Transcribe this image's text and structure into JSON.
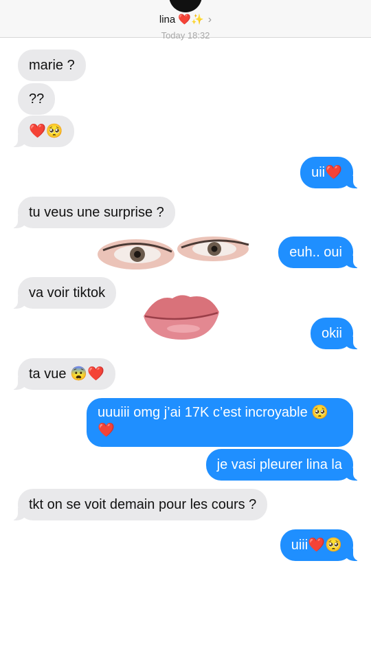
{
  "header": {
    "contact_name": "lina ❤️✨",
    "chevron": "›",
    "timestamp": "Today 18:32"
  },
  "messages": [
    {
      "side": "in",
      "text": "marie ?"
    },
    {
      "side": "in",
      "text": "??"
    },
    {
      "side": "in",
      "text": "❤️🥺"
    },
    {
      "side": "out",
      "text": "uii❤️"
    },
    {
      "side": "in",
      "text": "tu veus une surprise ?"
    },
    {
      "side": "out",
      "text": "euh.. oui"
    },
    {
      "side": "in",
      "text": "va voir tiktok"
    },
    {
      "side": "out",
      "text": "okii"
    },
    {
      "side": "in",
      "text": "ta vue 😨❤️"
    },
    {
      "side": "out",
      "text": "uuuiii omg j’ai 17K c’est incroyable 🥺❤️"
    },
    {
      "side": "out",
      "text": "je vasi pleurer lina la"
    },
    {
      "side": "in",
      "text": "tkt on se voit demain pour les cours ?"
    },
    {
      "side": "out",
      "text": "uiii❤️🥺"
    }
  ],
  "stickers": {
    "eyes": "eyes-sticker",
    "lips": "lips-sticker"
  },
  "colors": {
    "incoming_bubble": "#e9e9eb",
    "outgoing_bubble": "#1f8fff",
    "header_bg": "#f7f7f7"
  }
}
